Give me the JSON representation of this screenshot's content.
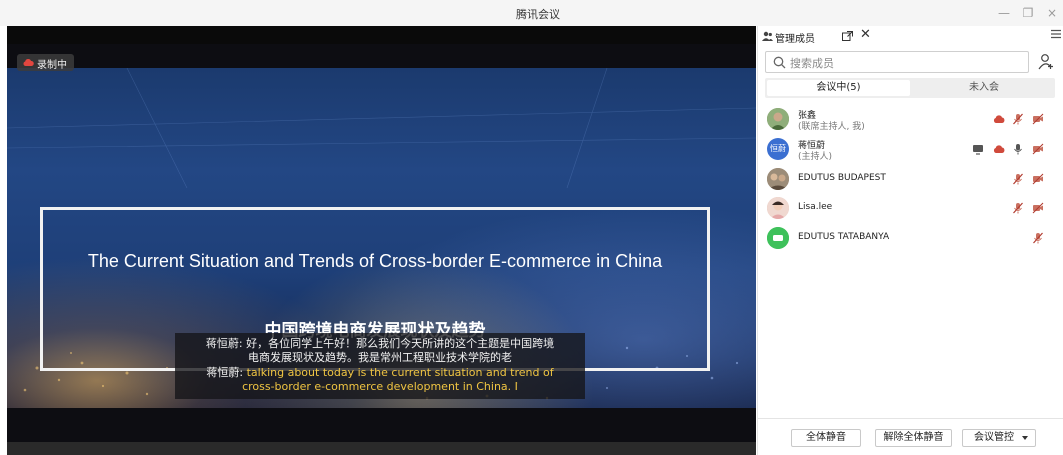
{
  "app": {
    "title": "腾讯会议"
  },
  "window": {
    "minimize": "—",
    "restore": "❐",
    "close": "×"
  },
  "meeting": {
    "recording_label": "录制中",
    "slide_title_en": "The Current Situation and Trends of Cross-border E-commerce in China",
    "slide_title_cn": "中国跨境电商发展现状及趋势",
    "subtitles": {
      "cn_speaker": "蒋恒蔚: ",
      "cn_line1": "好，各位同学上午好！那么我们今天所讲的这个主题是中国跨境",
      "cn_line2": "电商发展现状及趋势。我是常州工程职业技术学院的老",
      "en_speaker": "蒋恒蔚: ",
      "en_line1": "talking about today is the current situation and trend of",
      "en_line2": "cross-border e-commerce development in China. I"
    }
  },
  "panel": {
    "tab_label": "管理成员",
    "search_placeholder": "搜索成员",
    "tabs": {
      "in_meeting": "会议中(5)",
      "not_joined": "未入会"
    },
    "members": [
      {
        "name": "张鑫",
        "role": "(联席主持人, 我)",
        "avatar_color": "#6b8f5a",
        "icons": [
          "cloud-record-icon",
          "mic-muted-icon",
          "camera-off-icon"
        ]
      },
      {
        "name": "蒋恒蔚",
        "role": "(主持人)",
        "avatar_text": "恒蔚",
        "avatar_color": "#3b6fd1",
        "icons": [
          "screen-share-icon",
          "cloud-record-icon",
          "mic-active-icon",
          "camera-off-icon"
        ]
      },
      {
        "name": "EDUTUS BUDAPEST",
        "avatar_color": "#8b7b6a",
        "icons": [
          "mic-muted-icon",
          "camera-off-icon"
        ]
      },
      {
        "name": "Lisa.lee",
        "avatar_color": "#d9b8b0",
        "icons": [
          "mic-muted-icon",
          "camera-off-icon"
        ]
      },
      {
        "name": "EDUTUS TATABANYA",
        "avatar_color": "#3ec15b",
        "icons": [
          "mic-muted-icon"
        ]
      }
    ],
    "footer": {
      "mute_all": "全体静音",
      "unmute_all": "解除全体静音",
      "meeting_control": "会议管控"
    }
  },
  "colors": {
    "subtitle_translation": "#f0c542",
    "mic_muted": "#c0504d",
    "panel_border": "#e4e4e4"
  }
}
